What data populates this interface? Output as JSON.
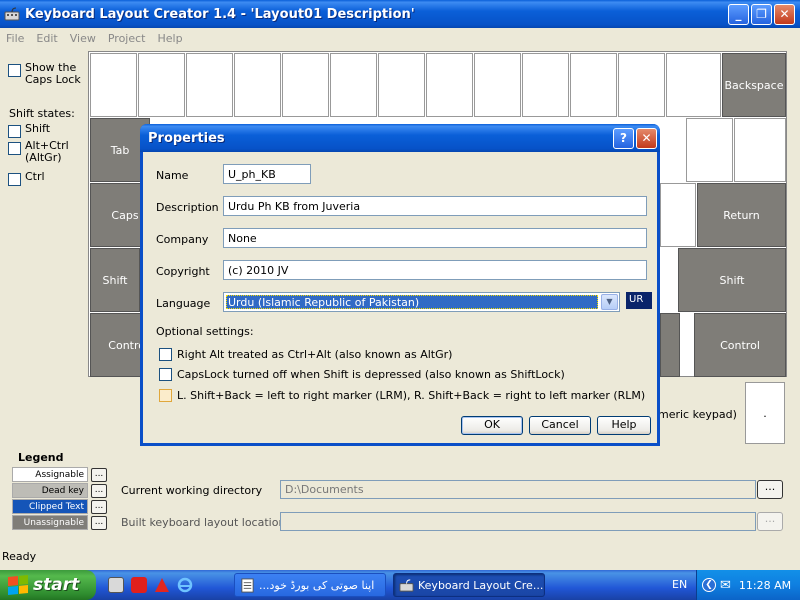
{
  "window": {
    "title": "Keyboard Layout Creator 1.4 - 'Layout01 Description'",
    "minimize_glyph": "_",
    "restore_glyph": "❐",
    "close_glyph": "✕"
  },
  "menu": [
    "File",
    "Edit",
    "View",
    "Project",
    "Help"
  ],
  "left_panel": {
    "show_caps_lock": "Show the Caps Lock",
    "shift_states_label": "Shift states:",
    "shift": "Shift",
    "altgr": "Alt+Ctrl (AltGr)",
    "ctrl": "Ctrl"
  },
  "keyboard": {
    "backspace": "Backspace",
    "tab": "Tab",
    "caps": "Caps",
    "return": "Return",
    "shift_left": "Shift",
    "shift_right": "Shift",
    "control_left": "Contro",
    "control_right": "Control",
    "numeric_keypad": "meric keypad)",
    "numpad_dot": "."
  },
  "legend": {
    "title": "Legend",
    "items": [
      {
        "label": "Assignable",
        "color": "#ffffff",
        "text_color": "#000000"
      },
      {
        "label": "Dead key",
        "color": "#bdbcb6",
        "text_color": "#000000"
      },
      {
        "label": "Clipped Text",
        "color": "#1555b8",
        "text_color": "#ffffff"
      },
      {
        "label": "Unassignable",
        "color": "#7f7d78",
        "text_color": "#ffffff"
      }
    ],
    "button_label": "..."
  },
  "directories": {
    "working_label": "Current working directory",
    "working_value": "D:\\Documents",
    "build_label": "Built keyboard layout location",
    "build_value": "",
    "browse_label": "..."
  },
  "status": "Ready",
  "dialog": {
    "title": "Properties",
    "help_glyph": "?",
    "close_glyph": "✕",
    "name_label": "Name",
    "name_value": "U_ph_KB",
    "description_label": "Description",
    "description_value": "Urdu Ph KB from Juveria",
    "company_label": "Company",
    "company_value": "None",
    "copyright_label": "Copyright",
    "copyright_value": "(c) 2010 JV",
    "language_label": "Language",
    "language_value": "Urdu (Islamic Republic of Pakistan)",
    "language_code": "UR",
    "optional_label": "Optional settings:",
    "opt_altgr": "Right Alt treated as Ctrl+Alt (also known as AltGr)",
    "opt_shiftlock": "CapsLock turned off when Shift is depressed (also known as ShiftLock)",
    "opt_lrm": "L. Shift+Back = left to right marker (LRM),  R. Shift+Back = right to left marker (RLM)",
    "ok": "OK",
    "cancel": "Cancel",
    "help": "Help"
  },
  "taskbar": {
    "start": "start",
    "items": [
      {
        "label": "...اپنا صوتی کی بورڈ خود",
        "active": false
      },
      {
        "label": "Keyboard Layout Cre...",
        "active": true
      }
    ],
    "language": "EN",
    "clock": "11:28 AM"
  }
}
